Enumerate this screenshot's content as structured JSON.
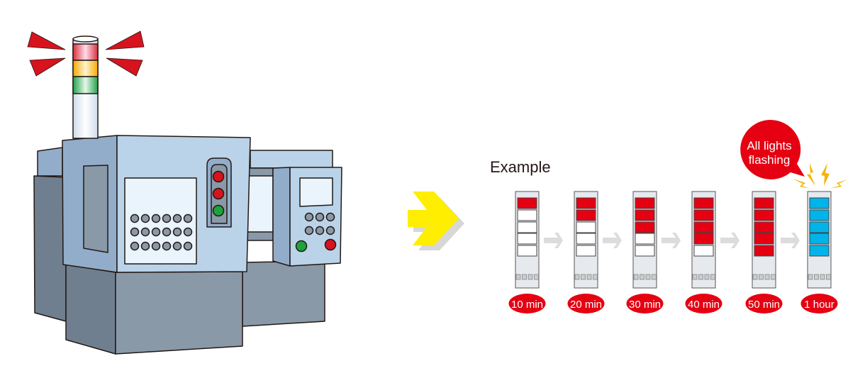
{
  "example_label": "Example",
  "callout": {
    "line1": "All lights",
    "line2": "flashing"
  },
  "colors": {
    "lit_red": "#e50012",
    "flash_blue": "#00b4ea",
    "badge_red": "#e50012",
    "arrow_yellow": "#ffee00",
    "arrow_gray": "#dcdcdc"
  },
  "steps": [
    {
      "time": "10 min",
      "lit": 1,
      "color": "red"
    },
    {
      "time": "20 min",
      "lit": 2,
      "color": "red"
    },
    {
      "time": "30 min",
      "lit": 3,
      "color": "red"
    },
    {
      "time": "40 min",
      "lit": 4,
      "color": "red"
    },
    {
      "time": "50 min",
      "lit": 5,
      "color": "red"
    },
    {
      "time": "1 hour",
      "lit": 5,
      "color": "blue",
      "flashing": true
    }
  ]
}
